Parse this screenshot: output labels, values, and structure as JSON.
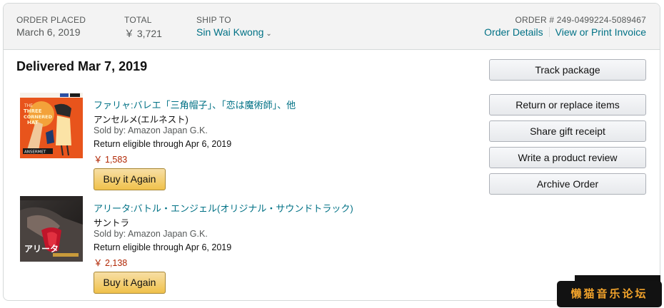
{
  "header": {
    "order_placed_label": "ORDER PLACED",
    "order_placed_value": "March 6, 2019",
    "total_label": "TOTAL",
    "total_value": "￥ 3,721",
    "ship_to_label": "SHIP TO",
    "ship_to_value": "Sin Wai Kwong",
    "order_number_label": "ORDER # 249-0499224-5089467",
    "order_details_link": "Order Details",
    "view_invoice_link": "View or Print Invoice"
  },
  "shipment": {
    "status": "Delivered Mar 7, 2019"
  },
  "items": [
    {
      "title": "ファリャ:バレエ「三角帽子」、「恋は魔術師」、他",
      "artist": "アンセルメ(エルネスト)",
      "seller": "Sold by: Amazon Japan G.K.",
      "return_info": "Return eligible through Apr 6, 2019",
      "price": "￥ 1,583",
      "buy_again_label": "Buy it Again"
    },
    {
      "title": "アリータ:バトル・エンジェル(オリジナル・サウンドトラック)",
      "artist": "サントラ",
      "seller": "Sold by: Amazon Japan G.K.",
      "return_info": "Return eligible through Apr 6, 2019",
      "price": "￥ 2,138",
      "buy_again_label": "Buy it Again"
    }
  ],
  "actions": {
    "track_package": "Track package",
    "return_replace": "Return or replace items",
    "share_gift_receipt": "Share gift receipt",
    "write_review": "Write a product review",
    "archive_order": "Archive Order"
  },
  "album_art": {
    "item1_text_a": "THE",
    "item1_text_b": "THREE",
    "item1_text_c": "CORNERED",
    "item1_text_d": "HAT",
    "item1_text_e": "ANSERMET",
    "item2_text_title": "アリータ"
  },
  "watermark": {
    "text": "懒猫音乐论坛"
  },
  "colors": {
    "link": "#007185",
    "price": "#b12704",
    "buy_button": "#f0c14b",
    "header_bg": "#f3f3f3"
  }
}
